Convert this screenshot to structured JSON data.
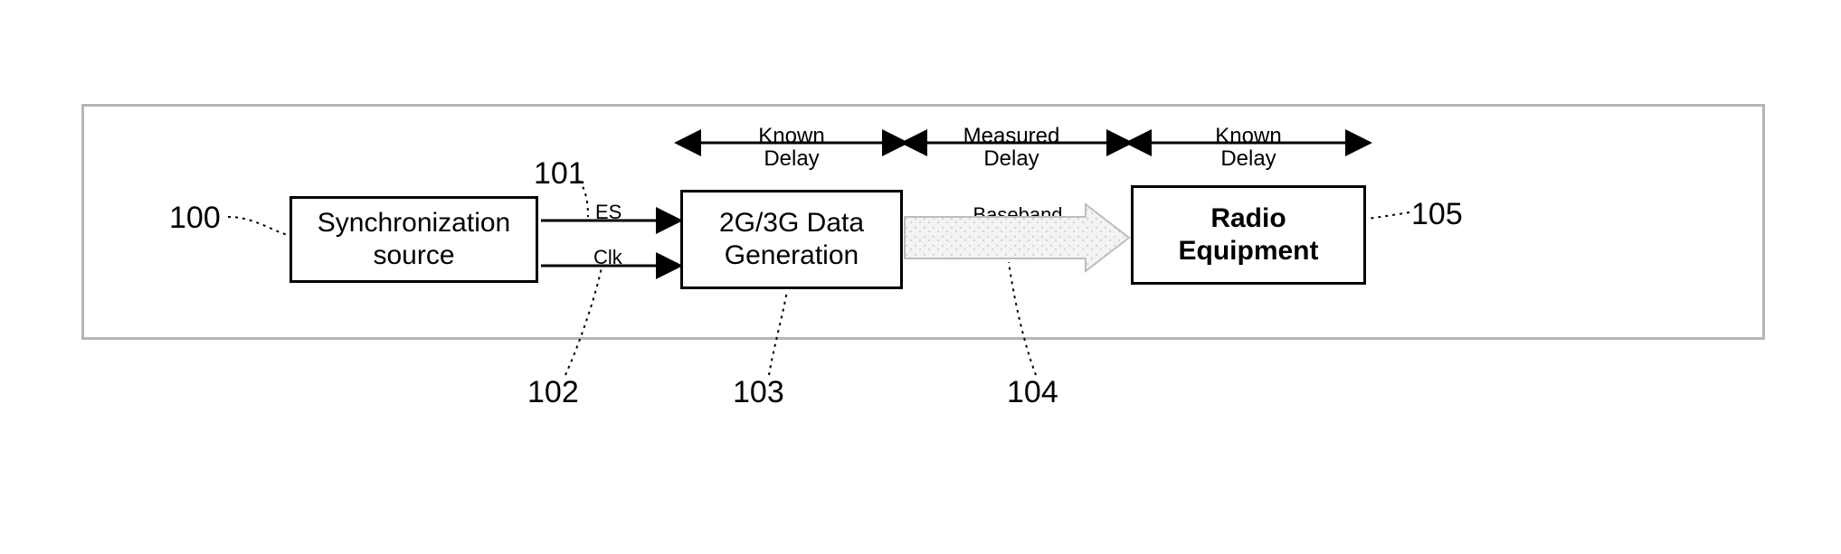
{
  "blocks": {
    "sync": {
      "label": "Synchronization\nsource"
    },
    "gen": {
      "label": "2G/3G Data\nGeneration"
    },
    "radio": {
      "label": "Radio\nEquipment"
    }
  },
  "signals": {
    "es": {
      "label": "ES"
    },
    "clk": {
      "label": "Clk"
    },
    "bb": {
      "label": "Baseband\nLink"
    }
  },
  "delays": {
    "left": {
      "label": "Known\nDelay"
    },
    "mid": {
      "label": "Measured\nDelay"
    },
    "right": {
      "label": "Known\nDelay"
    }
  },
  "refs": {
    "r100": "100",
    "r101": "101",
    "r102": "102",
    "r103": "103",
    "r104": "104",
    "r105": "105"
  }
}
